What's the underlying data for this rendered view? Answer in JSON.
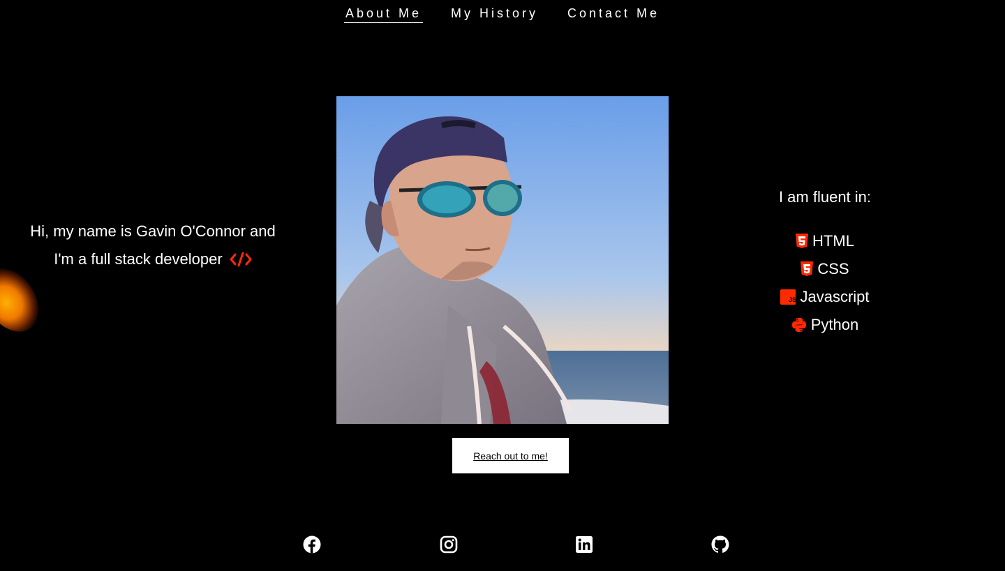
{
  "nav": {
    "items": [
      {
        "label": "About Me",
        "active": true
      },
      {
        "label": "My History",
        "active": false
      },
      {
        "label": "Contact Me",
        "active": false
      }
    ]
  },
  "intro": {
    "line1": "Hi, my name is Gavin O'Connor and",
    "line2": "I'm a full stack developer",
    "code_icon": "code-icon"
  },
  "photo": {
    "description_icon": "profile-photo"
  },
  "cta": {
    "label": "Reach out to me!"
  },
  "skills": {
    "title": "I am fluent in:",
    "items": [
      {
        "label": "HTML",
        "icon": "html5-icon"
      },
      {
        "label": "CSS",
        "icon": "css3-icon"
      },
      {
        "label": "Javascript",
        "icon": "js-icon"
      },
      {
        "label": "Python",
        "icon": "python-icon"
      }
    ]
  },
  "social": {
    "items": [
      {
        "icon": "facebook-icon"
      },
      {
        "icon": "instagram-icon"
      },
      {
        "icon": "linkedin-icon"
      },
      {
        "icon": "github-icon"
      }
    ]
  },
  "colors": {
    "background": "#000000",
    "text": "#ffffff",
    "accent": "#ff2a00",
    "button_bg": "#ffffff"
  }
}
